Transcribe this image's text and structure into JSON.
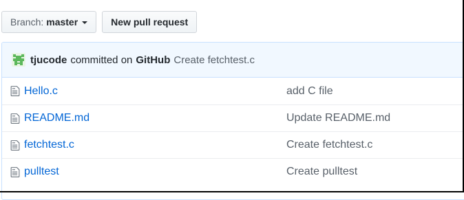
{
  "toolbar": {
    "branch_prefix": "Branch:",
    "branch_name": "master",
    "new_pr_label": "New pull request"
  },
  "commit": {
    "author": "tjucode",
    "verb": "committed on",
    "platform": "GitHub",
    "message": "Create fetchtest.c",
    "avatar_color": "#5cb85c"
  },
  "files": [
    {
      "name": "Hello.c",
      "message": "add C file",
      "icon": "file-icon"
    },
    {
      "name": "README.md",
      "message": "Update README.md",
      "icon": "file-icon"
    },
    {
      "name": "fetchtest.c",
      "message": "Create fetchtest.c",
      "icon": "file-icon"
    },
    {
      "name": "pulltest",
      "message": "Create pulltest",
      "icon": "file-icon"
    }
  ],
  "colors": {
    "link": "#0366d6",
    "muted": "#586069",
    "commit_bg": "#f1f8ff",
    "box_border": "#c8e1ff"
  }
}
